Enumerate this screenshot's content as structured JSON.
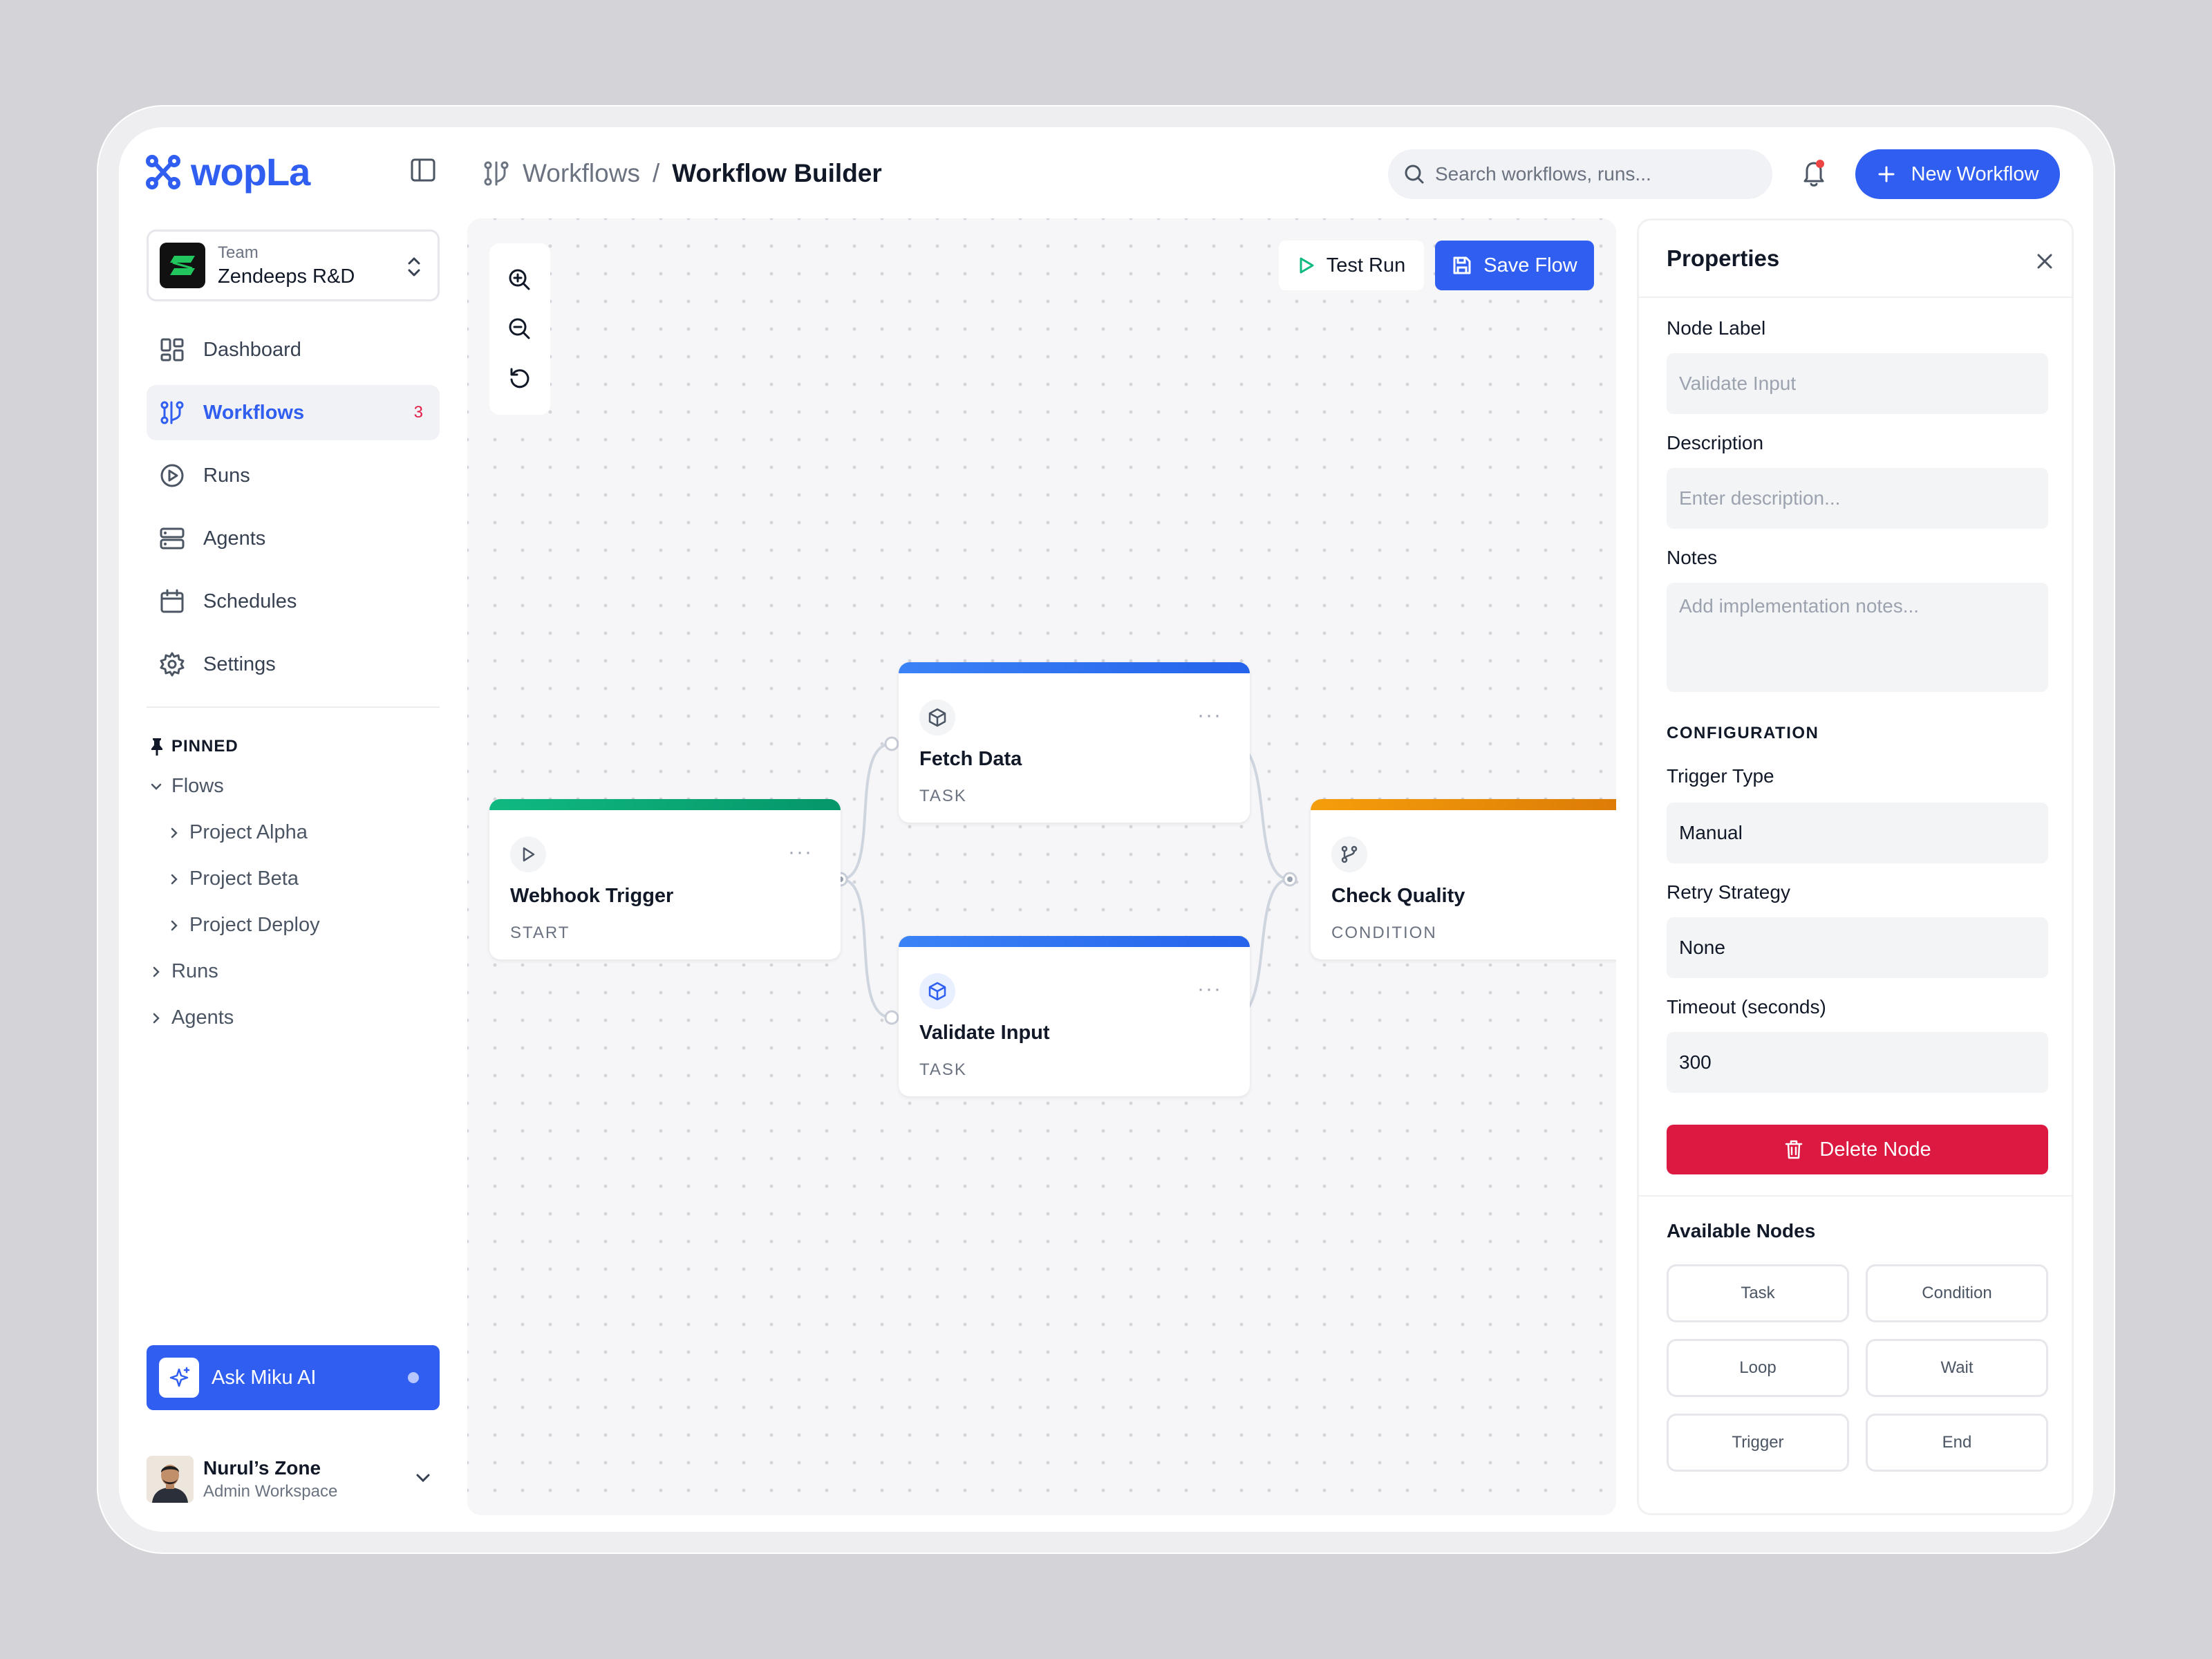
{
  "app": {
    "name": "wopLa"
  },
  "team": {
    "label": "Team",
    "name": "Zendeeps R&D"
  },
  "nav": {
    "items": [
      {
        "label": "Dashboard"
      },
      {
        "label": "Workflows",
        "badge": "3"
      },
      {
        "label": "Runs"
      },
      {
        "label": "Agents"
      },
      {
        "label": "Schedules"
      },
      {
        "label": "Settings"
      }
    ]
  },
  "pinned": {
    "heading": "PINNED",
    "tree": [
      {
        "label": "Flows"
      },
      {
        "label": "Project Alpha"
      },
      {
        "label": "Project Beta"
      },
      {
        "label": "Project Deploy"
      },
      {
        "label": "Runs"
      },
      {
        "label": "Agents"
      }
    ]
  },
  "ask_ai": {
    "label": "Ask Miku AI"
  },
  "user": {
    "name": "Nurul’s Zone",
    "role": "Admin Workspace"
  },
  "breadcrumb": {
    "parent": "Workflows",
    "separator": "/",
    "current": "Workflow Builder"
  },
  "search": {
    "placeholder": "Search workflows, runs..."
  },
  "header": {
    "new_workflow": "New Workflow"
  },
  "canvas": {
    "test_run": "Test Run",
    "save_flow": "Save Flow",
    "nodes": [
      {
        "title": "Webhook Trigger",
        "type": "START",
        "accent": "#10b981",
        "icon": "play-icon"
      },
      {
        "title": "Fetch Data",
        "type": "TASK",
        "accent": "#3b82f6",
        "icon": "cube-icon"
      },
      {
        "title": "Validate Input",
        "type": "TASK",
        "accent": "#3b82f6",
        "icon": "cube-icon"
      },
      {
        "title": "Check Quality",
        "type": "CONDITION",
        "accent": "#f59e0b",
        "icon": "branch-icon"
      }
    ]
  },
  "properties": {
    "title": "Properties",
    "node_label": {
      "label": "Node Label",
      "placeholder": "Validate Input"
    },
    "description": {
      "label": "Description",
      "placeholder": "Enter description..."
    },
    "notes": {
      "label": "Notes",
      "placeholder": "Add implementation notes..."
    },
    "config_heading": "CONFIGURATION",
    "trigger_type": {
      "label": "Trigger Type",
      "value": "Manual"
    },
    "retry_strategy": {
      "label": "Retry Strategy",
      "value": "None"
    },
    "timeout": {
      "label": "Timeout (seconds)",
      "value": "300"
    },
    "delete_label": "Delete Node",
    "available_title": "Available Nodes",
    "available_nodes": [
      "Task",
      "Condition",
      "Loop",
      "Wait",
      "Trigger",
      "End"
    ]
  },
  "colors": {
    "primary": "#2f5ef0",
    "danger": "#dc1940",
    "start": "#10b981",
    "condition": "#f59e0b"
  }
}
